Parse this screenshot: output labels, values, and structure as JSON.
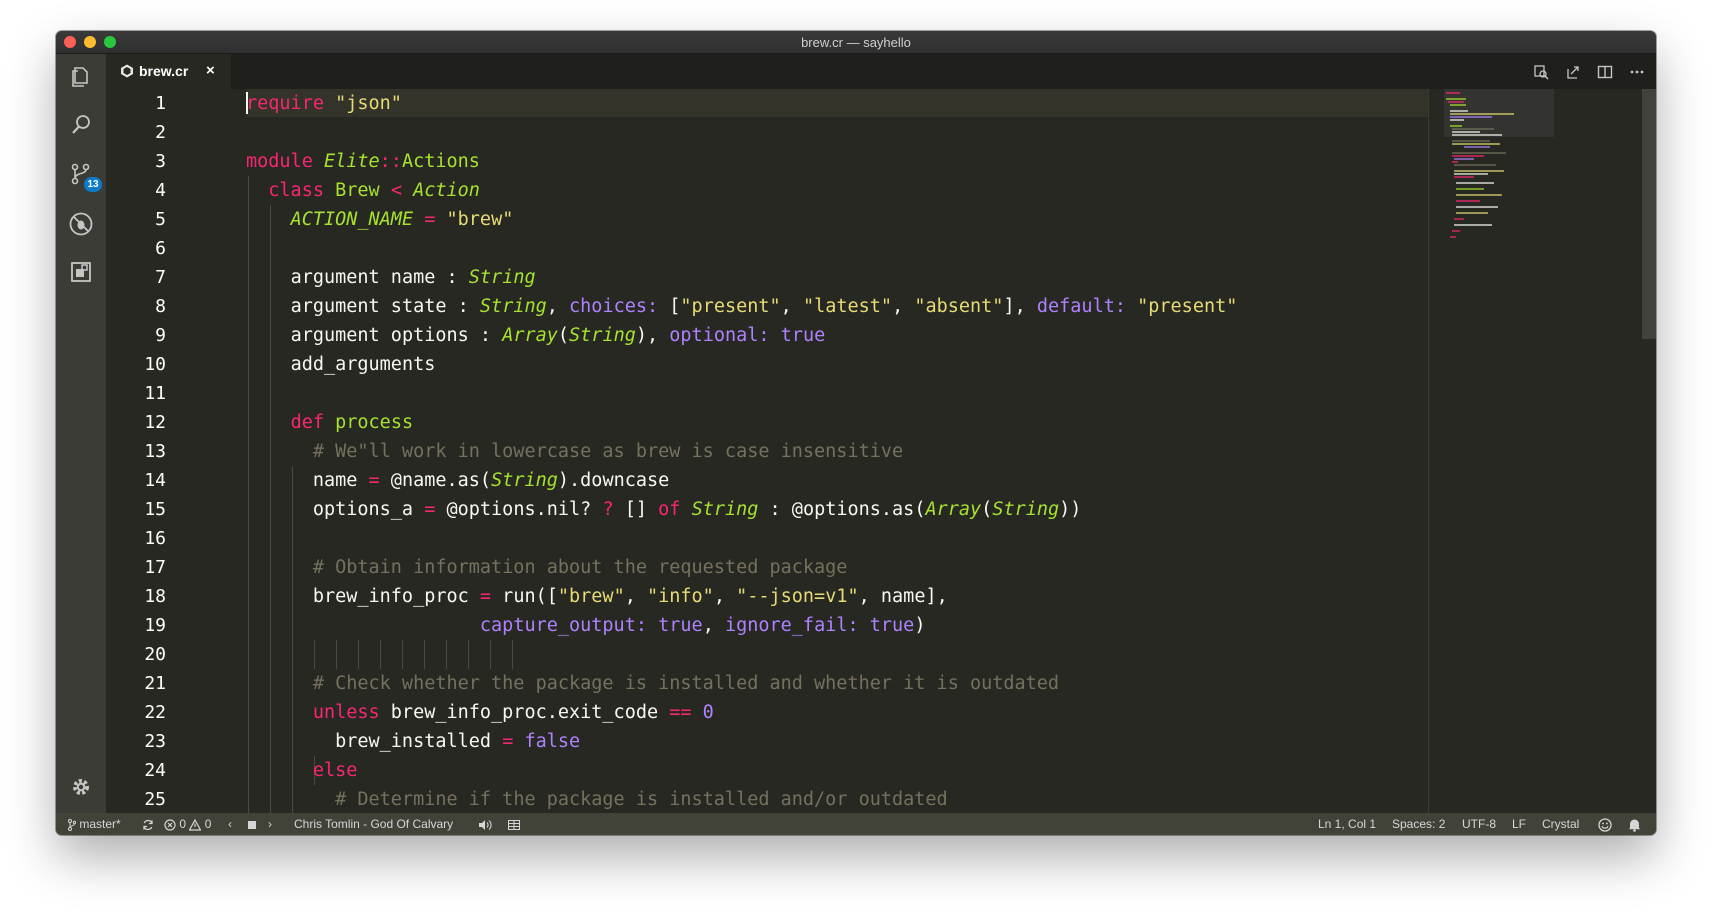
{
  "window": {
    "title": "brew.cr — sayhello"
  },
  "activity_bar": {
    "icons": [
      "files-icon",
      "search-icon",
      "source-control-icon",
      "debug-icon",
      "extensions-icon",
      "gear-icon"
    ],
    "source_control_badge": "13"
  },
  "tabs": [
    {
      "label": "brew.cr",
      "close": "×",
      "icon": "crystal-file-icon"
    }
  ],
  "editor_actions": [
    "open-changes-icon",
    "open-preview-icon",
    "split-editor-icon",
    "more-icon"
  ],
  "line_numbers": [
    "1",
    "2",
    "3",
    "4",
    "5",
    "6",
    "7",
    "8",
    "9",
    "10",
    "11",
    "12",
    "13",
    "14",
    "15",
    "16",
    "17",
    "18",
    "19",
    "20",
    "21",
    "22",
    "23",
    "24",
    "25"
  ],
  "code": {
    "l1": {
      "kw": "require",
      "str": "\"json\""
    },
    "l3": {
      "kw": "module",
      "ns": "Elite",
      "sep": "::",
      "name": "Actions"
    },
    "l4": {
      "kw": "class",
      "name": "Brew",
      "op": "<",
      "parent": "Action"
    },
    "l5": {
      "const": "ACTION_NAME",
      "op": "=",
      "str": "\"brew\""
    },
    "l7": {
      "a": "argument name : ",
      "type": "String"
    },
    "l8": {
      "a": "argument state : ",
      "type": "String",
      "b": ", ",
      "sym1": "choices:",
      "c": " [",
      "s1": "\"present\"",
      "d": ", ",
      "s2": "\"latest\"",
      "e": ", ",
      "s3": "\"absent\"",
      "f": "], ",
      "sym2": "default:",
      "g": " ",
      "s4": "\"present\""
    },
    "l9": {
      "a": "argument options : ",
      "type1": "Array",
      "b": "(",
      "type2": "String",
      "c": "), ",
      "sym": "optional:",
      "d": " ",
      "val": "true"
    },
    "l10": {
      "a": "add_arguments"
    },
    "l12": {
      "kw": "def",
      "name": "process"
    },
    "l13": {
      "com": "# We\"ll work in lowercase as brew is case insensitive"
    },
    "l14": {
      "a": "name ",
      "op": "=",
      "b": " @name.as(",
      "type": "String",
      "c": ").downcase"
    },
    "l15": {
      "a": "options_a ",
      "op": "=",
      "b": " @options.nil? ",
      "q": "?",
      "c": " [] ",
      "of": "of",
      "d": " ",
      "type1": "String",
      "e": " : @options.as(",
      "type2": "Array",
      "f": "(",
      "type3": "String",
      "g": "))"
    },
    "l17": {
      "com": "# Obtain information about the requested package"
    },
    "l18": {
      "a": "brew_info_proc ",
      "op": "=",
      "b": " run([",
      "s1": "\"brew\"",
      "c": ", ",
      "s2": "\"info\"",
      "d": ", ",
      "s3": "\"--json=v1\"",
      "e": ", name],"
    },
    "l19": {
      "sym1": "capture_output:",
      "a": " ",
      "v1": "true",
      "b": ", ",
      "sym2": "ignore_fail:",
      "c": " ",
      "v2": "true",
      "d": ")"
    },
    "l21": {
      "com": "# Check whether the package is installed and whether it is outdated"
    },
    "l22": {
      "kw": "unless",
      "a": " brew_info_proc.exit_code ",
      "op": "==",
      "b": " ",
      "num": "0"
    },
    "l23": {
      "a": "brew_installed ",
      "op": "=",
      "b": " ",
      "val": "false"
    },
    "l24": {
      "kw": "else"
    },
    "l25": {
      "com": "# Determine if the package is installed and/or outdated"
    }
  },
  "status_bar": {
    "branch": "master*",
    "errors": "0",
    "warnings": "0",
    "track": "Chris Tomlin - God Of Calvary",
    "position": "Ln 1, Col 1",
    "spaces": "Spaces: 2",
    "encoding": "UTF-8",
    "eol": "LF",
    "language": "Crystal"
  },
  "colors": {
    "background": "#272822",
    "keyword": "#f92672",
    "string": "#e6db74",
    "type": "#a6e22e",
    "symbol": "#ae81ff",
    "comment": "#75715e",
    "statusbar": "#414339",
    "badge": "#0e7acb"
  }
}
